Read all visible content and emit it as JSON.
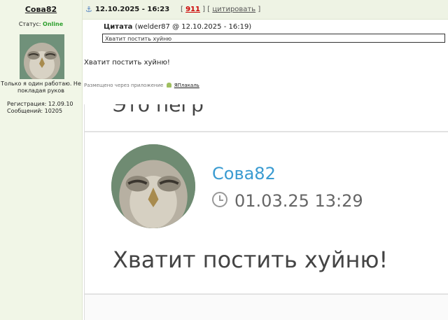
{
  "sidebar": {
    "username": "Сова82",
    "status_label": "Статус:",
    "status_value": "Online",
    "motto": "Только я один работаю. Не покладая руков",
    "registration": "Регистрация: 12.09.10",
    "messages": "Сообщений: 10205"
  },
  "post": {
    "date": "12.10.2025 - 16:23",
    "number": "911",
    "quote_label": "цитировать",
    "quote_header_bold": "Цитата",
    "quote_header_meta": "(welder87 @ 12.10.2025 - 16:19)",
    "quote_text": "Хватит постить хуйню",
    "text": "Хватит постить хуйню!",
    "posted_via": "Размещено через приложение",
    "app_name": "ЯПлакаль"
  },
  "screenshot": {
    "cutoff_text": "Это пегр",
    "username": "Сова82",
    "time": "01.03.25 13:29",
    "message": "Хватит постить хуйню!"
  }
}
